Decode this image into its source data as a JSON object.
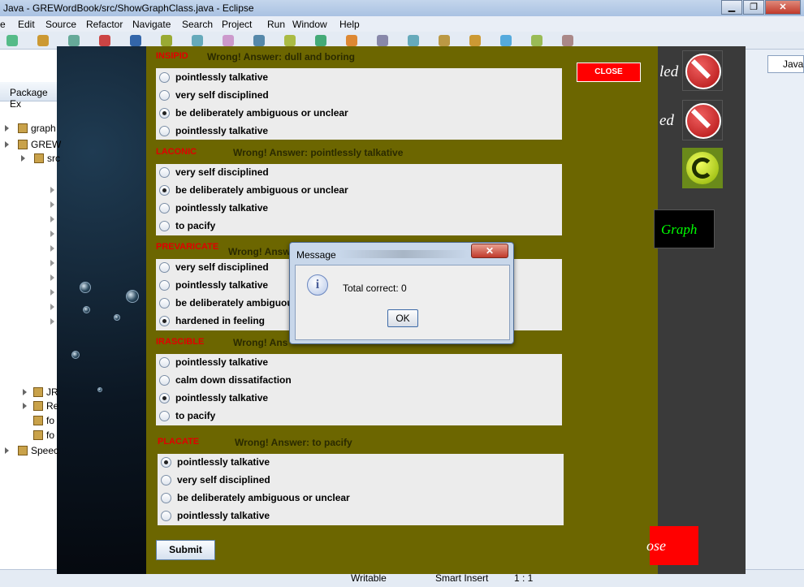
{
  "eclipse": {
    "title": "Java - GREWordBook/src/ShowGraphClass.java - Eclipse",
    "menu": [
      "e",
      "Edit",
      "Source",
      "Refactor",
      "Navigate",
      "Search",
      "Project",
      "Run",
      "Window",
      "Help"
    ],
    "package_explorer_label": "Package Ex",
    "tree": [
      "graph",
      "GREW",
      "src",
      "JR",
      "Re",
      "fo",
      "fo",
      "Speec"
    ],
    "perspective": "Java",
    "status": [
      "Writable",
      "Smart Insert",
      "1 : 1"
    ]
  },
  "game": {
    "close_label": "CLOSE",
    "submit_label": "Submit",
    "side_text_1": "led",
    "side_text_2": "ed",
    "graph_label": "Graph",
    "bottom_text": "ose",
    "questions": [
      {
        "word": "INSIPID",
        "feedback": "Wrong! Answer: dull and boring",
        "options": [
          "pointlessly talkative",
          "very self disciplined",
          "be deliberately ambiguous or unclear",
          "pointlessly talkative"
        ],
        "selected": 2
      },
      {
        "word": "LACONIC",
        "feedback": "Wrong! Answer: pointlessly talkative",
        "options": [
          "very self disciplined",
          "be deliberately ambiguous or unclear",
          "pointlessly talkative",
          "to pacify"
        ],
        "selected": 1
      },
      {
        "word": "PREVARICATE",
        "feedback": "Wrong! Answ",
        "options": [
          "very self disciplined",
          "pointlessly talkative",
          "be deliberately ambiguou",
          "hardened in feeling"
        ],
        "selected": 3
      },
      {
        "word": "IRASCIBLE",
        "feedback": "Wrong! Ans",
        "options": [
          "pointlessly talkative",
          "calm down dissatifaction",
          "pointlessly talkative",
          "to pacify"
        ],
        "selected": 2
      },
      {
        "word": "PLACATE",
        "feedback": "Wrong! Answer: to pacify",
        "options": [
          "pointlessly talkative",
          "very self disciplined",
          "be deliberately ambiguous or unclear",
          "pointlessly talkative"
        ],
        "selected": 0
      }
    ]
  },
  "message": {
    "title": "Message",
    "close_glyph": "✕",
    "icon": "info-icon",
    "text": "Total correct: 0",
    "ok_label": "OK"
  }
}
